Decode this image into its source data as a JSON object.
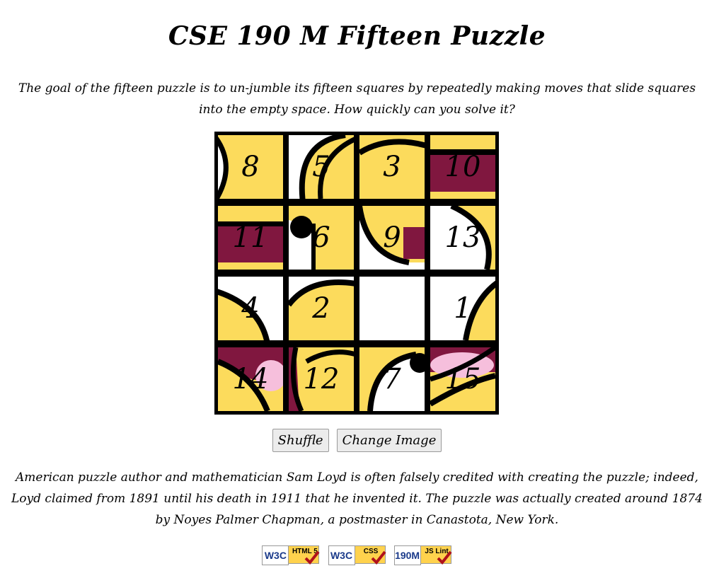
{
  "title": "CSE 190 M Fifteen Puzzle",
  "intro": "The goal of the fifteen puzzle is to un-jumble its fifteen squares by repeatedly making moves that slide squares into the empty space. How quickly can you solve it?",
  "board": {
    "rows": 4,
    "cols": 4,
    "tiles": [
      [
        8,
        5,
        3,
        10
      ],
      [
        11,
        6,
        9,
        13
      ],
      [
        4,
        2,
        null,
        1
      ],
      [
        14,
        12,
        7,
        15
      ]
    ],
    "colors": {
      "yellow": "#fcdb5c",
      "maroon": "#80173f",
      "pink": "#f6bfdc",
      "white": "#ffffff",
      "black": "#000000"
    }
  },
  "controls": {
    "shuffle_label": "Shuffle",
    "change_image_label": "Change Image"
  },
  "outro": "American puzzle author and mathematician Sam Loyd is often falsely credited with creating the puzzle; indeed, Loyd claimed from 1891 until his death in 1911 that he invented it. The puzzle was actually created around 1874 by Noyes Palmer Chapman, a postmaster in Canastota, New York.",
  "badges": [
    {
      "left": "W3C",
      "tag": "HTML 5",
      "icon": "w3c-html5-badge"
    },
    {
      "left": "W3C",
      "tag": "CSS",
      "icon": "w3c-css-badge"
    },
    {
      "left": "190M",
      "tag": "JS Lint",
      "icon": "jslint-badge"
    }
  ]
}
